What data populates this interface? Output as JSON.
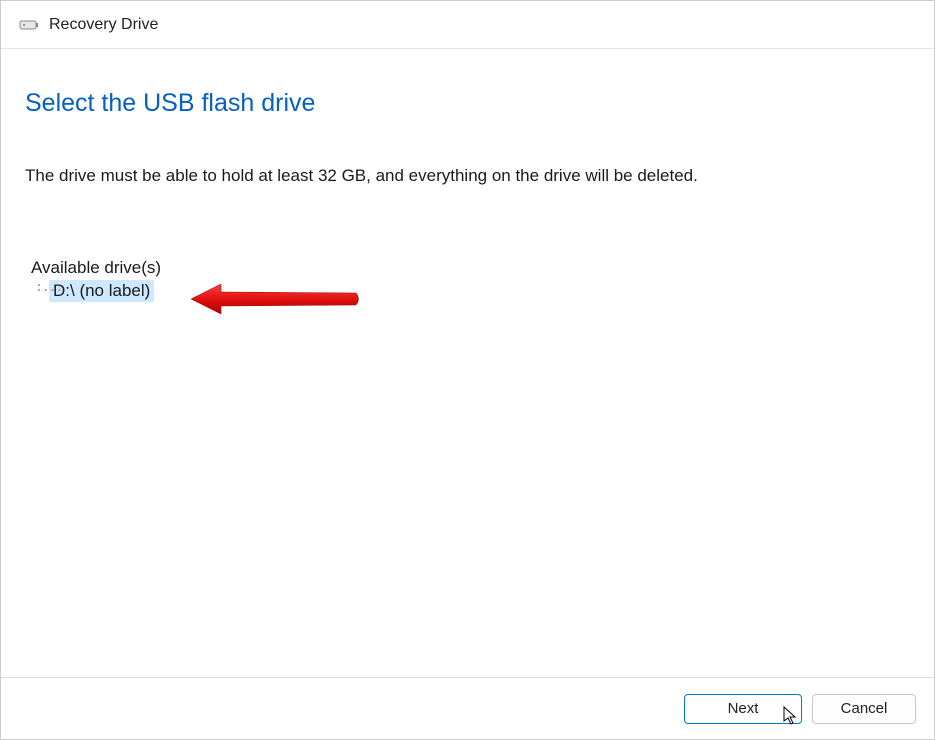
{
  "titlebar": {
    "title": "Recovery Drive"
  },
  "main": {
    "heading": "Select the USB flash drive",
    "description": "The drive must be able to hold at least 32 GB, and everything on the drive will be deleted.",
    "drives_label": "Available drive(s)",
    "drives": [
      {
        "label": "D:\\ (no label)"
      }
    ]
  },
  "footer": {
    "next_label": "Next",
    "cancel_label": "Cancel"
  }
}
